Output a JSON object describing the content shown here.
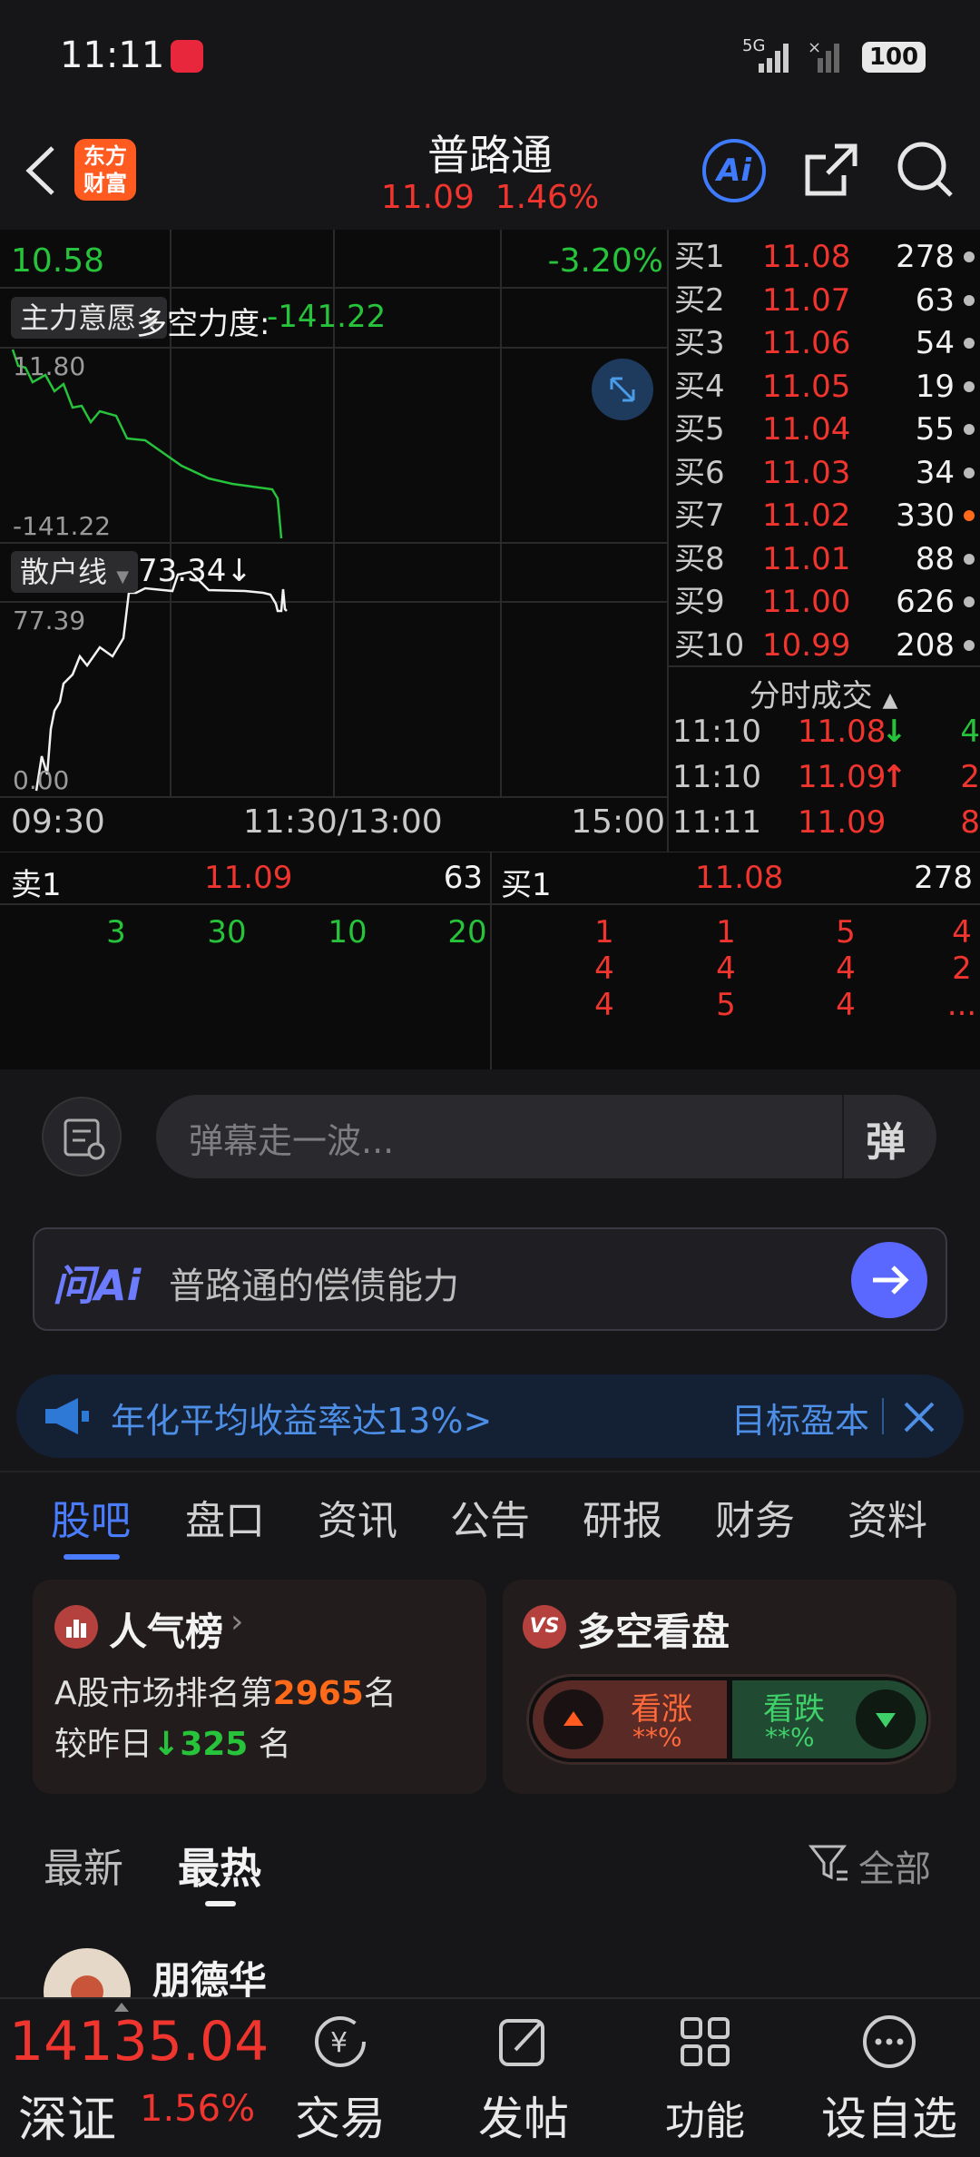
{
  "status": {
    "time": "11:11",
    "network": "5G",
    "battery": "100"
  },
  "header": {
    "title": "普路通",
    "price": "11.09",
    "change": "1.46%",
    "logo_line1": "东方",
    "logo_line2": "财富",
    "ai_label": "Ai"
  },
  "chart": {
    "top_price": "10.58",
    "top_pct": "-3.20%",
    "indicator1_name": "主力意愿",
    "indicator1_label": "多空力度:",
    "indicator1_value": "-141.22",
    "ind1_max": "11.80",
    "ind1_min": "-141.22",
    "indicator2_name": "散户线",
    "indicator2_value": "73.34↓",
    "ind2_max": "77.39",
    "ind2_min": "0.00",
    "time_start": "09:30",
    "time_mid": "11:30/13:00",
    "time_end": "15:00"
  },
  "orderbook": [
    {
      "label": "买1",
      "price": "11.08",
      "volume": "278",
      "dot": "grey"
    },
    {
      "label": "买2",
      "price": "11.07",
      "volume": "63",
      "dot": "grey"
    },
    {
      "label": "买3",
      "price": "11.06",
      "volume": "54",
      "dot": "grey"
    },
    {
      "label": "买4",
      "price": "11.05",
      "volume": "19",
      "dot": "grey"
    },
    {
      "label": "买5",
      "price": "11.04",
      "volume": "55",
      "dot": "grey"
    },
    {
      "label": "买6",
      "price": "11.03",
      "volume": "34",
      "dot": "grey"
    },
    {
      "label": "买7",
      "price": "11.02",
      "volume": "330",
      "dot": "orange"
    },
    {
      "label": "买8",
      "price": "11.01",
      "volume": "88",
      "dot": "grey"
    },
    {
      "label": "买9",
      "price": "11.00",
      "volume": "626",
      "dot": "grey"
    },
    {
      "label": "买10",
      "price": "10.99",
      "volume": "208",
      "dot": "grey"
    }
  ],
  "trades_title": "分时成交",
  "trades": [
    {
      "time": "11:10",
      "price": "11.08",
      "arrow": "↓",
      "vol": "4",
      "vcolor": "green"
    },
    {
      "time": "11:10",
      "price": "11.09",
      "arrow": "↑",
      "vol": "2",
      "vcolor": "red"
    },
    {
      "time": "11:11",
      "price": "11.09",
      "arrow": "",
      "vol": "8",
      "vcolor": "red"
    }
  ],
  "queue": {
    "sell_label": "卖1",
    "sell_price": "11.09",
    "sell_vol": "63",
    "buy_label": "买1",
    "buy_price": "11.08",
    "buy_vol": "278",
    "sell_orders": [
      "3",
      "30",
      "10",
      "20"
    ],
    "buy_orders": [
      [
        "1",
        "1",
        "5",
        "4"
      ],
      [
        "4",
        "4",
        "4",
        "2"
      ],
      [
        "4",
        "5",
        "4",
        "..."
      ]
    ]
  },
  "danmu": {
    "placeholder": "弹幕走一波...",
    "button": "弹"
  },
  "ask_ai": {
    "brand": "问Ai",
    "query": "普路通的偿债能力"
  },
  "ad": {
    "text": "年化平均收益率达13%>",
    "right": "目标盈本"
  },
  "tabs": [
    "股吧",
    "盘口",
    "资讯",
    "公告",
    "研报",
    "财务",
    "资料"
  ],
  "popularity": {
    "title": "人气榜",
    "line1_prefix": "A股市场排名第",
    "rank": "2965",
    "line1_suffix": "名",
    "line2_prefix": "较昨日",
    "delta": "325",
    "line2_suffix": "名"
  },
  "vote": {
    "title": "多空看盘",
    "up_label": "看涨",
    "up_value": "**%",
    "down_label": "看跌",
    "down_value": "**%"
  },
  "feed_tabs": {
    "latest": "最新",
    "hot": "最热",
    "filter": "全部"
  },
  "post": {
    "author": "朋德华"
  },
  "bottom_nav": {
    "index_value": "14135.04",
    "index_name": "深证",
    "index_change": "1.56%",
    "trade": "交易",
    "post": "发帖",
    "functions": "功能",
    "watchlist": "设自选"
  },
  "colors": {
    "up": "#f0342e",
    "down": "#26c33b",
    "accent": "#4a7cff"
  }
}
